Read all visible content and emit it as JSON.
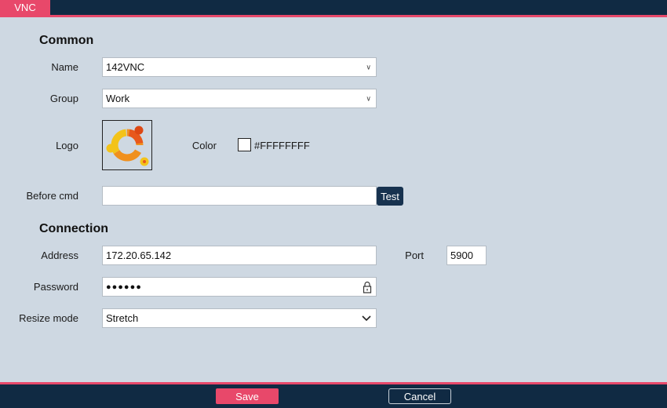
{
  "tab": {
    "label": "VNC"
  },
  "common": {
    "title": "Common",
    "name_label": "Name",
    "name_value": "142VNC",
    "group_label": "Group",
    "group_value": "Work",
    "logo_label": "Logo",
    "color_label": "Color",
    "color_value": "#FFFFFFFF",
    "before_cmd_label": "Before cmd",
    "before_cmd_value": "",
    "test_button": "Test"
  },
  "connection": {
    "title": "Connection",
    "address_label": "Address",
    "address_value": "172.20.65.142",
    "port_label": "Port",
    "port_value": "5900",
    "password_label": "Password",
    "password_value": "●●●●●●",
    "resize_label": "Resize mode",
    "resize_value": "Stretch"
  },
  "footer": {
    "save_button": "Save",
    "cancel_button": "Cancel"
  },
  "icons": {
    "logo": "ubuntu-logo-icon",
    "dropdown": "chevron-down-icon",
    "lock": "lock-icon"
  },
  "colors": {
    "accent": "#e8486a",
    "header_bg": "#102a43",
    "panel_bg": "#ced8e2",
    "test_button_bg": "#17324f"
  }
}
